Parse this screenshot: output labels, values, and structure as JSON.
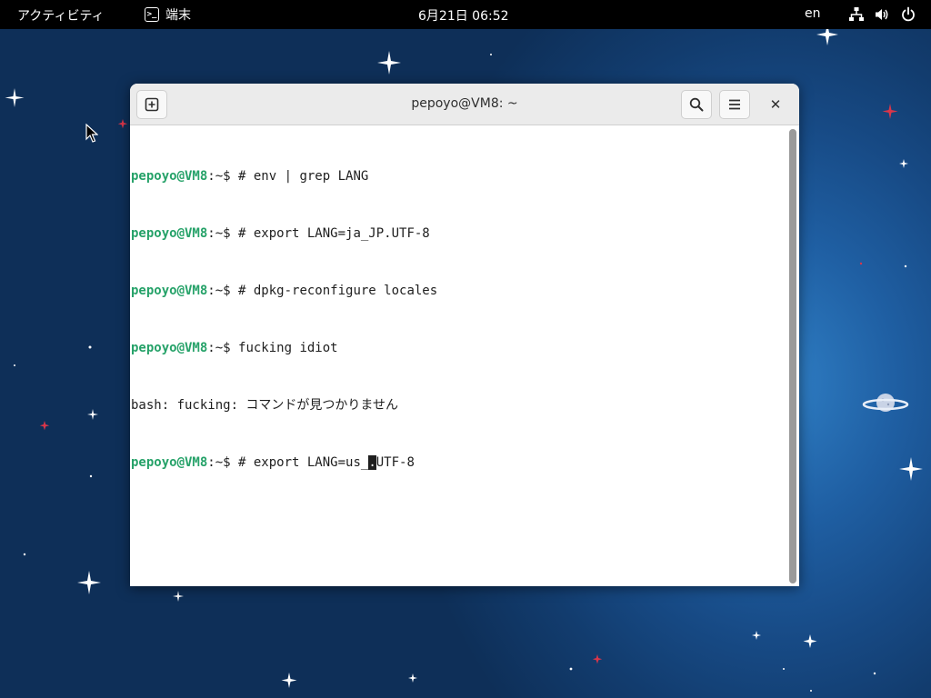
{
  "topbar": {
    "activities": "アクティビティ",
    "app_name": "端末",
    "app_icon": "terminal-icon",
    "clock": "6月21日 06:52",
    "lang": "en",
    "icons": [
      "network-icon",
      "volume-icon",
      "power-icon"
    ]
  },
  "window": {
    "title": "pepoyo@VM8: ~",
    "buttons": [
      "new-tab-icon",
      "search-icon",
      "menu-icon",
      "close-icon"
    ],
    "close_glyph": "✕"
  },
  "terminal": {
    "lines": [
      {
        "prompt_user": "pepoyo@VM8",
        "prompt_rest": ":~$ # ",
        "command": "env | grep LANG"
      },
      {
        "prompt_user": "pepoyo@VM8",
        "prompt_rest": ":~$ # ",
        "command": "export LANG=ja_JP.UTF-8"
      },
      {
        "prompt_user": "pepoyo@VM8",
        "prompt_rest": ":~$ # ",
        "command": "dpkg-reconfigure locales"
      },
      {
        "prompt_user": "pepoyo@VM8",
        "prompt_rest": ":~$ ",
        "command": "fucking idiot"
      },
      {
        "output": "bash: fucking: コマンドが見つかりません"
      },
      {
        "prompt_user": "pepoyo@VM8",
        "prompt_rest": ":~$ # ",
        "command_before": "export LANG=us_",
        "cursor_char": ".",
        "command_after": "UTF-8"
      }
    ]
  },
  "colors": {
    "prompt_user": "#26a269",
    "desktop_bg": "#174a85",
    "topbar_bg": "#000000"
  }
}
